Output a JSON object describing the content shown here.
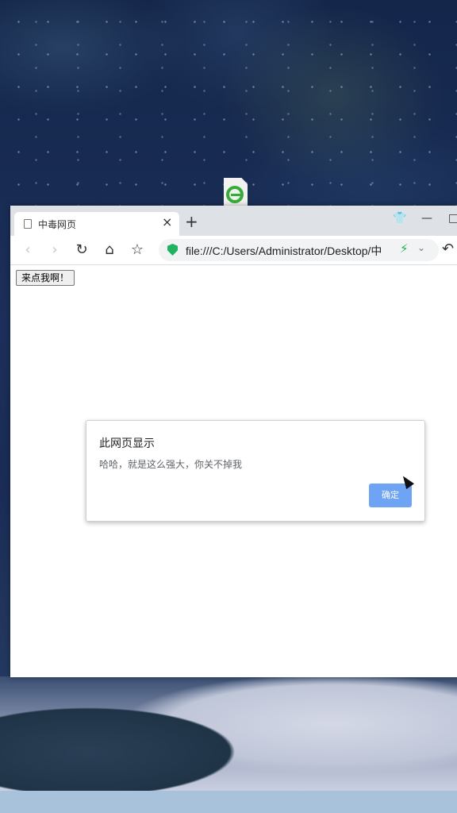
{
  "desktop": {
    "icon_name": "ie-icon"
  },
  "browser": {
    "tab": {
      "title": "中毒网页",
      "close": "×"
    },
    "new_tab": "+",
    "window_controls": {
      "skin": "👕",
      "minimize": "—",
      "maximize": "□"
    },
    "nav": {
      "back": "‹",
      "forward": "›",
      "reload": "↻",
      "home": "⌂",
      "favorite": "☆",
      "undo": "↶"
    },
    "address": {
      "url": "file:///C:/Users/Administrator/Desktop/中",
      "speed": "⚡",
      "dropdown": "⌄"
    },
    "accent": "#20b460"
  },
  "page": {
    "button_label": "来点我啊！"
  },
  "alert": {
    "title": "此网页显示",
    "message": "哈哈，就是这么强大，你关不掉我",
    "ok_label": "确定",
    "ok_color": "#6fa4f5"
  }
}
